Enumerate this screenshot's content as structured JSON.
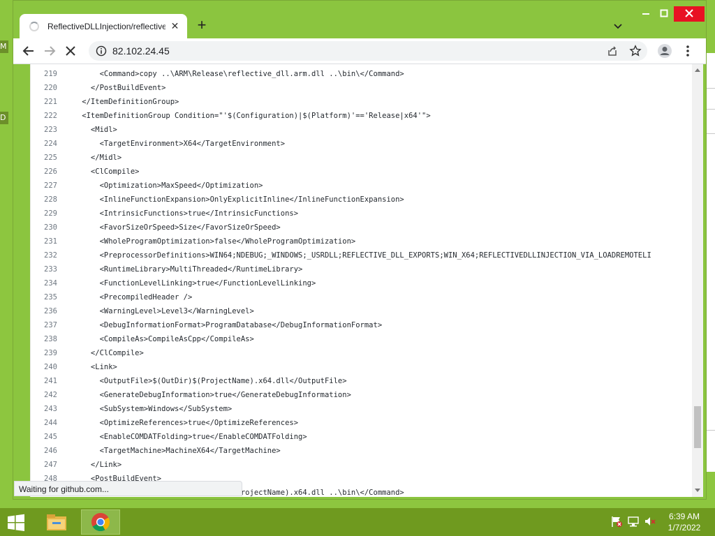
{
  "desktop": {
    "sliver_1": "M",
    "sliver_2": "D"
  },
  "browser": {
    "tab": {
      "title": "ReflectiveDLLInjection/reflective_"
    },
    "address": "82.102.24.45",
    "status": "Waiting for github.com..."
  },
  "code_lines": [
    {
      "n": "219",
      "t": "        <Command>copy ..\\ARM\\Release\\reflective_dll.arm.dll ..\\bin\\</Command>"
    },
    {
      "n": "220",
      "t": "      </PostBuildEvent>"
    },
    {
      "n": "221",
      "t": "    </ItemDefinitionGroup>"
    },
    {
      "n": "222",
      "t": "    <ItemDefinitionGroup Condition=\"'$(Configuration)|$(Platform)'=='Release|x64'\">"
    },
    {
      "n": "223",
      "t": "      <Midl>"
    },
    {
      "n": "224",
      "t": "        <TargetEnvironment>X64</TargetEnvironment>"
    },
    {
      "n": "225",
      "t": "      </Midl>"
    },
    {
      "n": "226",
      "t": "      <ClCompile>"
    },
    {
      "n": "227",
      "t": "        <Optimization>MaxSpeed</Optimization>"
    },
    {
      "n": "228",
      "t": "        <InlineFunctionExpansion>OnlyExplicitInline</InlineFunctionExpansion>"
    },
    {
      "n": "229",
      "t": "        <IntrinsicFunctions>true</IntrinsicFunctions>"
    },
    {
      "n": "230",
      "t": "        <FavorSizeOrSpeed>Size</FavorSizeOrSpeed>"
    },
    {
      "n": "231",
      "t": "        <WholeProgramOptimization>false</WholeProgramOptimization>"
    },
    {
      "n": "232",
      "t": "        <PreprocessorDefinitions>WIN64;NDEBUG;_WINDOWS;_USRDLL;REFLECTIVE_DLL_EXPORTS;WIN_X64;REFLECTIVEDLLINJECTION_VIA_LOADREMOTELI"
    },
    {
      "n": "233",
      "t": "        <RuntimeLibrary>MultiThreaded</RuntimeLibrary>"
    },
    {
      "n": "234",
      "t": "        <FunctionLevelLinking>true</FunctionLevelLinking>"
    },
    {
      "n": "235",
      "t": "        <PrecompiledHeader />"
    },
    {
      "n": "236",
      "t": "        <WarningLevel>Level3</WarningLevel>"
    },
    {
      "n": "237",
      "t": "        <DebugInformationFormat>ProgramDatabase</DebugInformationFormat>"
    },
    {
      "n": "238",
      "t": "        <CompileAs>CompileAsCpp</CompileAs>"
    },
    {
      "n": "239",
      "t": "      </ClCompile>"
    },
    {
      "n": "240",
      "t": "      <Link>"
    },
    {
      "n": "241",
      "t": "        <OutputFile>$(OutDir)$(ProjectName).x64.dll</OutputFile>"
    },
    {
      "n": "242",
      "t": "        <GenerateDebugInformation>true</GenerateDebugInformation>"
    },
    {
      "n": "243",
      "t": "        <SubSystem>Windows</SubSystem>"
    },
    {
      "n": "244",
      "t": "        <OptimizeReferences>true</OptimizeReferences>"
    },
    {
      "n": "245",
      "t": "        <EnableCOMDATFolding>true</EnableCOMDATFolding>"
    },
    {
      "n": "246",
      "t": "        <TargetMachine>MachineX64</TargetMachine>"
    },
    {
      "n": "247",
      "t": "      </Link>"
    },
    {
      "n": "248",
      "t": "      <PostBuildEvent>"
    },
    {
      "n": "249",
      "t": "        <Command>copy ..\\x64\\Release\\$(ProjectName).x64.dll ..\\bin\\</Command>"
    }
  ],
  "taskbar": {
    "time": "6:39 AM",
    "date": "1/7/2022",
    "apps": [
      {
        "name": "file-explorer-icon"
      },
      {
        "name": "chrome-icon"
      }
    ]
  },
  "colors": {
    "desktop": "#8dc63f",
    "taskbar": "#6f9a1f",
    "close_button": "#e81123"
  }
}
